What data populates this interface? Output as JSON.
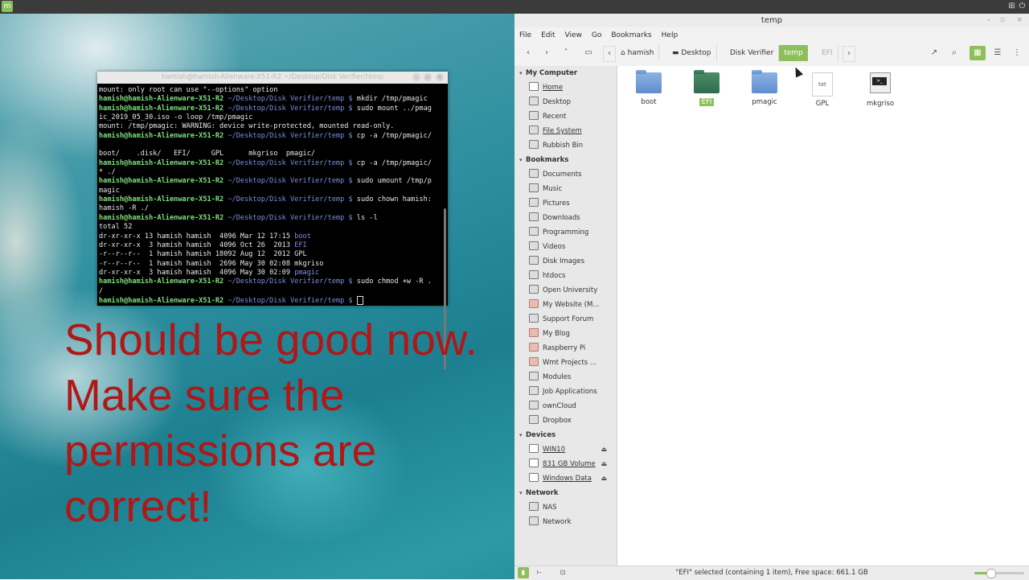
{
  "terminal": {
    "title": "hamish@hamish-Alienware-X51-R2 ~/Desktop/Disk Verifier/temp",
    "prompt_user": "hamish@hamish-Alienware-X51-R2",
    "prompt_dir": "~/Desktop/Disk Verifier/temp $",
    "lines": [
      {
        "kind": "out",
        "text": "mount: only root can use \"--options\" option"
      },
      {
        "kind": "cmd",
        "text": " mkdir /tmp/pmagic"
      },
      {
        "kind": "cmd",
        "text": " sudo mount ../pmag"
      },
      {
        "kind": "out",
        "text": "ic_2019_05_30.iso -o loop /tmp/pmagic"
      },
      {
        "kind": "out",
        "text": "mount: /tmp/pmagic: WARNING: device write-protected, mounted read-only."
      },
      {
        "kind": "cmd",
        "text": " cp -a /tmp/pmagic/"
      },
      {
        "kind": "out",
        "text": ""
      },
      {
        "kind": "out",
        "text": "boot/    .disk/   EFI/     GPL      mkgriso  pmagic/"
      },
      {
        "kind": "cmd",
        "text": " cp -a /tmp/pmagic/"
      },
      {
        "kind": "out",
        "text": "* ./"
      },
      {
        "kind": "cmd",
        "text": " sudo umount /tmp/p"
      },
      {
        "kind": "out",
        "text": "magic"
      },
      {
        "kind": "cmd",
        "text": " sudo chown hamish:"
      },
      {
        "kind": "out",
        "text": "hamish -R ./"
      },
      {
        "kind": "cmd",
        "text": " ls -l"
      },
      {
        "kind": "out",
        "text": "total 52"
      },
      {
        "kind": "ls",
        "text": "dr-xr-xr-x 13 hamish hamish  4096 Mar 12 17:15 ",
        "name": "boot"
      },
      {
        "kind": "ls",
        "text": "dr-xr-xr-x  3 hamish hamish  4096 Oct 26  2013 ",
        "name": "EFI"
      },
      {
        "kind": "out",
        "text": "-r--r--r--  1 hamish hamish 18092 Aug 12  2012 GPL"
      },
      {
        "kind": "out",
        "text": "-r--r--r--  1 hamish hamish  2696 May 30 02:08 mkgriso"
      },
      {
        "kind": "ls",
        "text": "dr-xr-xr-x  3 hamish hamish  4096 May 30 02:09 ",
        "name": "pmagic"
      },
      {
        "kind": "cmd",
        "text": " sudo chmod +w -R ."
      },
      {
        "kind": "out",
        "text": "/"
      },
      {
        "kind": "cmd",
        "text": " "
      }
    ]
  },
  "overlay_text": "Should be good now. Make sure the permissions are correct!",
  "fm": {
    "window_title": "temp",
    "menu": [
      "File",
      "Edit",
      "View",
      "Go",
      "Bookmarks",
      "Help"
    ],
    "breadcrumbs": [
      "hamish",
      "Desktop",
      "Disk Verifier",
      "temp",
      "EFI"
    ],
    "sections": {
      "computer": "My Computer",
      "bookmarks": "Bookmarks",
      "devices": "Devices",
      "network": "Network"
    },
    "computer_items": [
      "Home",
      "Desktop",
      "Recent",
      "File System",
      "Rubbish Bin"
    ],
    "bookmark_items": [
      "Documents",
      "Music",
      "Pictures",
      "Downloads",
      "Programming",
      "Videos",
      "Disk Images",
      "htdocs",
      "Open University",
      "My Website (M...",
      "Support Forum",
      "My Blog",
      "Raspberry Pi",
      "Wmt Projects ...",
      "Modules",
      "Job Applications",
      "ownCloud",
      "Dropbox"
    ],
    "device_items": [
      "WIN10",
      "831 GB Volume",
      "Windows Data"
    ],
    "network_items": [
      "NAS",
      "Network"
    ],
    "files": [
      {
        "name": "boot",
        "type": "folder"
      },
      {
        "name": "EFI",
        "type": "folder-selected"
      },
      {
        "name": "pmagic",
        "type": "folder"
      },
      {
        "name": "GPL",
        "type": "text"
      },
      {
        "name": "mkgriso",
        "type": "executable"
      }
    ],
    "status": "\"EFI\" selected (containing 1 item), Free space: 661.1 GB",
    "zoom_fraction": 0.33,
    "accent": "#8fbf5c"
  }
}
